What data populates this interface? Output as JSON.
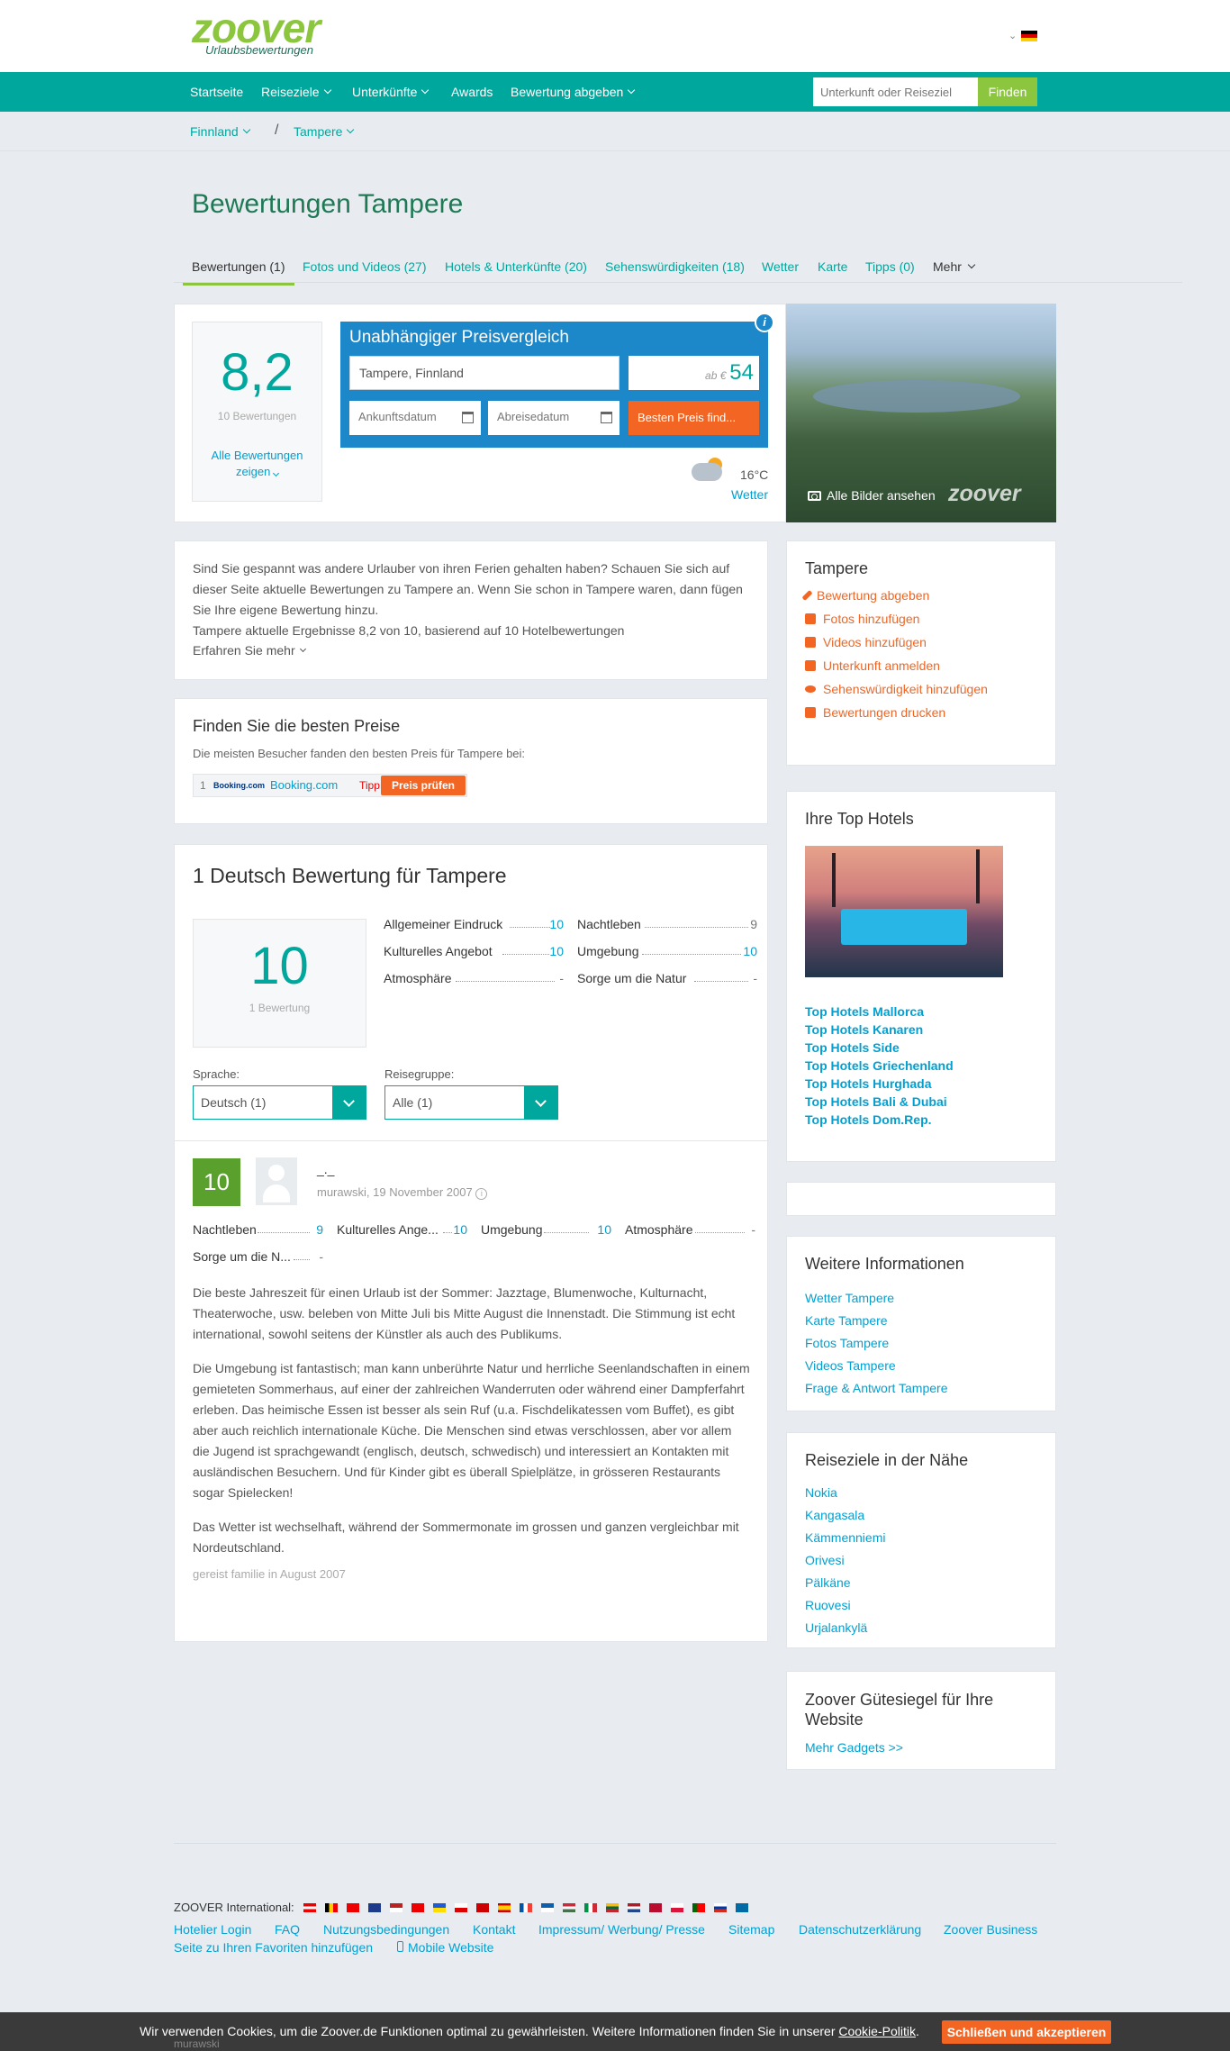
{
  "header": {
    "logo_name": "zoover",
    "logo_sub": "Urlaubsbewertungen",
    "lang": "⌄"
  },
  "nav": {
    "items": [
      {
        "label": "Startseite"
      },
      {
        "label": "Reiseziele"
      },
      {
        "label": "Unterkünfte"
      },
      {
        "label": "Awards"
      },
      {
        "label": "Bewertung abgeben"
      }
    ],
    "search_placeholder": "Unterkunft oder Reiseziel",
    "search_button": "Finden"
  },
  "breadcrumb": {
    "country": "Finnland",
    "city": "Tampere",
    "separator": "/"
  },
  "page": {
    "title": "Bewertungen Tampere",
    "tabs": [
      {
        "label": "Bewertungen (1)"
      },
      {
        "label": "Fotos und Videos (27)"
      },
      {
        "label": "Hotels & Unterkünfte (20)"
      },
      {
        "label": "Sehenswürdigkeiten (18)"
      },
      {
        "label": "Wetter"
      },
      {
        "label": "Karte"
      },
      {
        "label": "Tipps (0)"
      },
      {
        "label": "Mehr"
      }
    ]
  },
  "summary": {
    "score": "8,2",
    "reviews_count": "10 Bewertungen",
    "all_reviews_line1": "Alle Bewertungen",
    "all_reviews_line2": "zeigen"
  },
  "price_compare": {
    "title": "Unabhängiger Preisvergleich",
    "destination": "Tampere, Finnland",
    "from_label": "ab €",
    "from_price": "54",
    "arrival_placeholder": "Ankunftsdatum",
    "departure_placeholder": "Abreisedatum",
    "button": "Besten Preis find...",
    "info": "i"
  },
  "weather": {
    "temp": "16°C",
    "link": "Wetter"
  },
  "photo": {
    "all_images": "Alle Bilder ansehen",
    "watermark": "zoover"
  },
  "intro": {
    "text": "Sind Sie gespannt was andere Urlauber von ihren Ferien gehalten haben? Schauen Sie sich auf dieser Seite aktuelle Bewertungen zu Tampere an. Wenn Sie schon in Tampere waren, dann fügen Sie Ihre eigene Bewertung hinzu.",
    "result": "Tampere aktuelle Ergebnisse 8,2 von 10, basierend auf 10 Hotelbewertungen",
    "learn_more": "Erfahren Sie mehr"
  },
  "actions": {
    "title": "Tampere",
    "items": [
      {
        "label": "Bewertung abgeben",
        "icon": "pencil-icon"
      },
      {
        "label": "Fotos hinzufügen",
        "icon": "camera-icon"
      },
      {
        "label": "Videos hinzufügen",
        "icon": "video-icon"
      },
      {
        "label": "Unterkunft anmelden",
        "icon": "home-icon"
      },
      {
        "label": "Sehenswürdigkeit hinzufügen",
        "icon": "eye-icon"
      },
      {
        "label": "Bewertungen drucken",
        "icon": "print-icon"
      }
    ]
  },
  "best_price": {
    "title": "Finden Sie die besten Preise",
    "desc": "Die meisten Besucher fanden den besten Preis für Tampere bei:",
    "rank": "1",
    "logo_text": "Booking.com",
    "provider": "Booking.com",
    "tip": "Tipp",
    "button": "Preis prüfen"
  },
  "top_hotels": {
    "title": "Ihre Top Hotels",
    "links": [
      {
        "label": "Top Hotels Mallorca"
      },
      {
        "label": "Top Hotels Kanaren"
      },
      {
        "label": "Top Hotels Side"
      },
      {
        "label": "Top Hotels Griechenland"
      },
      {
        "label": "Top Hotels Hurghada"
      },
      {
        "label": "Top Hotels Bali & Dubai"
      },
      {
        "label": "Top Hotels Dom.Rep."
      }
    ]
  },
  "reviews": {
    "title": "1 Deutsch Bewertung für Tampere",
    "score": "10",
    "count": "1 Bewertung",
    "ratings": [
      {
        "label": "Allgemeiner Eindruck",
        "value": "10"
      },
      {
        "label": "Nachtleben",
        "value": "9"
      },
      {
        "label": "Kulturelles Angebot",
        "value": "10"
      },
      {
        "label": "Umgebung",
        "value": "10"
      },
      {
        "label": "Atmosphäre",
        "value": "-"
      },
      {
        "label": "Sorge um die Natur",
        "value": "-"
      }
    ],
    "language_label": "Sprache:",
    "language_value": "Deutsch (1)",
    "group_label": "Reisegruppe:",
    "group_value": "Alle (1)"
  },
  "review": {
    "score": "10",
    "name": "_._",
    "meta": "murawski, 19 November 2007",
    "sub_ratings": [
      {
        "label": "Nachtleben",
        "value": "9"
      },
      {
        "label": "Kulturelles Ange...",
        "value": "10"
      },
      {
        "label": "Umgebung",
        "value": "10"
      },
      {
        "label": "Atmosphäre",
        "value": "-"
      },
      {
        "label": "Sorge um die N...",
        "value": "-"
      }
    ],
    "p1": "Die beste Jahreszeit für einen Urlaub ist der Sommer: Jazztage, Blumenwoche, Kulturnacht, Theaterwoche, usw. beleben von Mitte Juli bis Mitte August die Innenstadt. Die Stimmung ist echt international, sowohl seitens der Künstler als auch des Publikums.",
    "p2": "Die Umgebung ist fantastisch; man kann unberührte Natur und herrliche Seenlandschaften in einem gemieteten Sommerhaus, auf einer der zahlreichen Wanderruten oder während einer Dampferfahrt erleben. Das heimische Essen ist besser als sein Ruf (u.a. Fischdelikatessen vom Buffet), es gibt aber auch reichlich internationale Küche. Die Menschen sind etwas verschlossen, aber vor allem die Jugend ist sprachgewandt (englisch, deutsch, schwedisch) und interessiert an Kontakten mit ausländischen Besuchern. Und für Kinder gibt es überall Spielplätze, in grösseren Restaurants sogar Spielecken!",
    "p3": "Das Wetter ist wechselhaft, während der Sommermonate im grossen und ganzen vergleichbar mit Nordeutschland.",
    "travelled": "gereist familie in August 2007"
  },
  "further": {
    "title": "Weitere Informationen",
    "links": [
      {
        "label": "Wetter Tampere"
      },
      {
        "label": "Karte Tampere"
      },
      {
        "label": "Fotos Tampere"
      },
      {
        "label": "Videos Tampere"
      },
      {
        "label": "Frage & Antwort Tampere"
      }
    ]
  },
  "nearby": {
    "title": "Reiseziele in der Nähe",
    "links": [
      {
        "label": "Nokia"
      },
      {
        "label": "Kangasala"
      },
      {
        "label": "Kämmenniemi"
      },
      {
        "label": "Orivesi"
      },
      {
        "label": "Pälkäne"
      },
      {
        "label": "Ruovesi"
      },
      {
        "label": "Urjalankylä"
      }
    ]
  },
  "seal": {
    "title": "Zoover Gütesiegel für Ihre Website",
    "link": "Mehr Gadgets >>"
  },
  "footer": {
    "international": "ZOOVER International:",
    "links": [
      {
        "label": "Hotelier Login"
      },
      {
        "label": "FAQ"
      },
      {
        "label": "Nutzungsbedingungen"
      },
      {
        "label": "Kontakt"
      },
      {
        "label": "Impressum/ Werbung/ Presse"
      },
      {
        "label": "Sitemap"
      },
      {
        "label": "Datenschutzerklärung"
      },
      {
        "label": "Zoover Business"
      },
      {
        "label": "Seite zu Ihren Favoriten hinzufügen"
      },
      {
        "label": "Mobile Website"
      }
    ]
  },
  "cookie": {
    "text": "Wir verwenden Cookies, um die Zoover.de Funktionen optimal zu gewährleisten. Weitere Informationen finden Sie in unserer",
    "link": "Cookie-Politik",
    "button": "Schließen und akzeptieren",
    "behind": "murawski"
  },
  "colors": {
    "teal": "#00a79d",
    "green": "#8cc63f",
    "blue": "#1c87c9",
    "orange": "#f26522",
    "link": "#00a0d2"
  }
}
